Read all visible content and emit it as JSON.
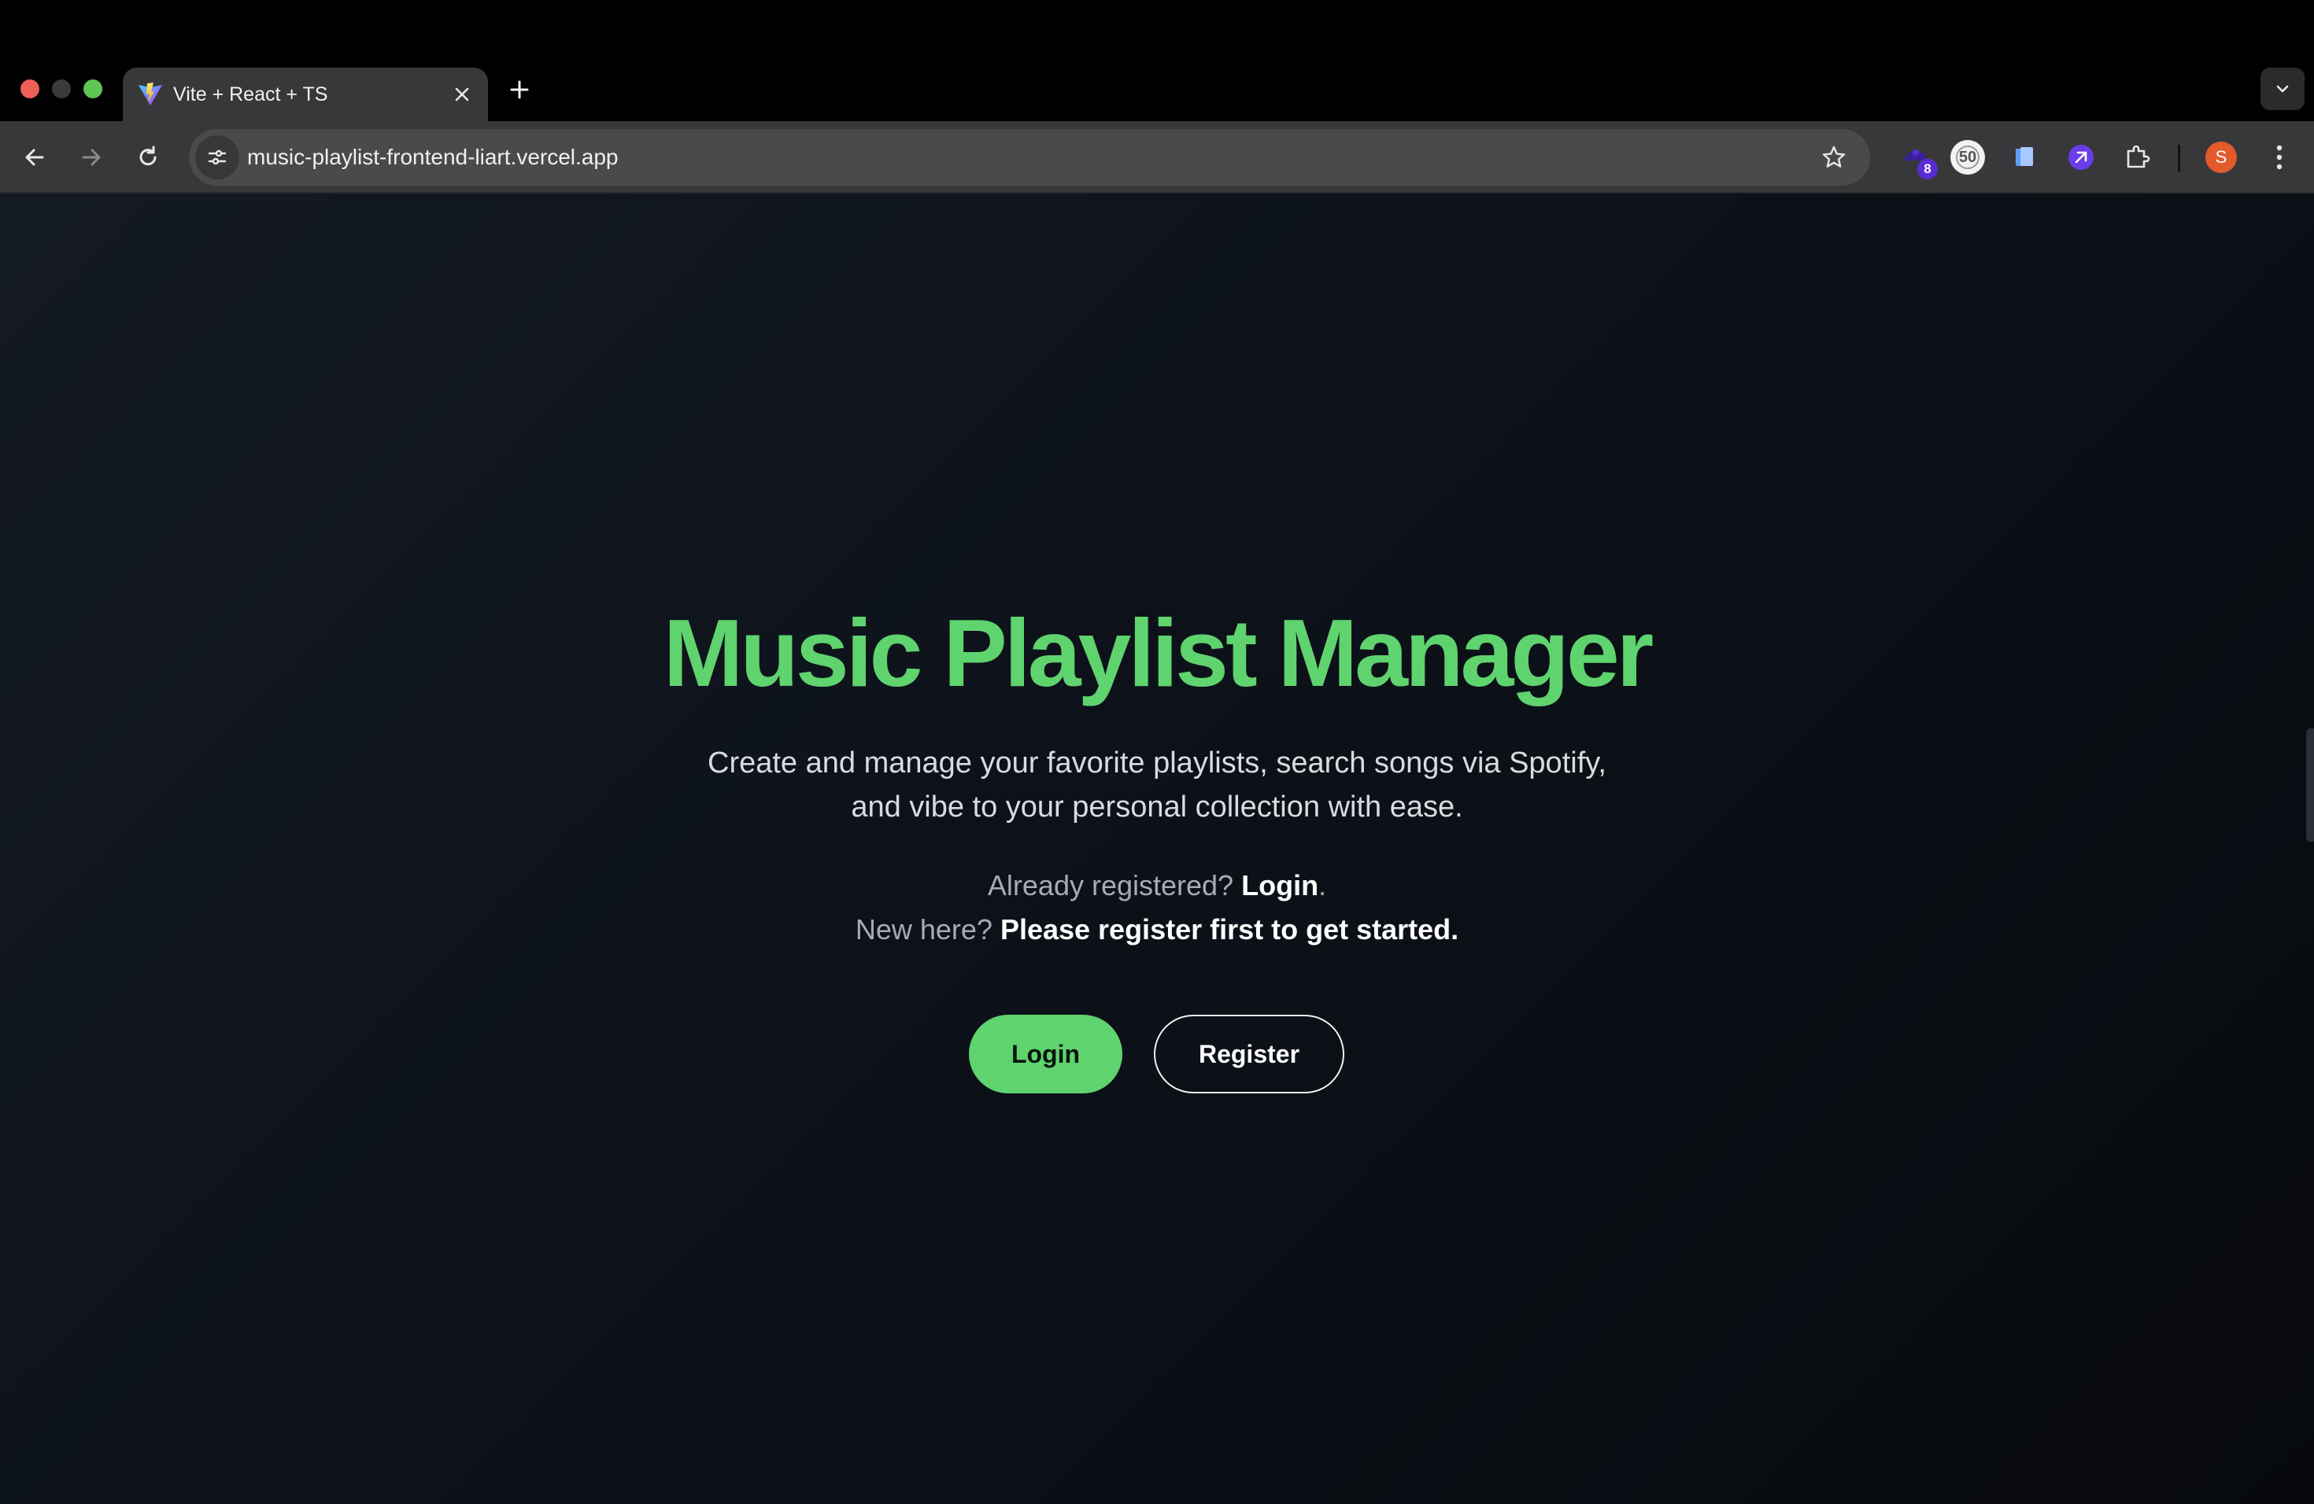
{
  "browser": {
    "tab": {
      "title": "Vite + React + TS",
      "favicon": "vite-logo-icon"
    },
    "toolbar": {
      "url": "music-playlist-frontend-liart.vercel.app",
      "extensions": [
        {
          "name": "extension-icon-1",
          "badge": "8"
        },
        {
          "name": "extension-icon-2",
          "label": "50"
        },
        {
          "name": "extension-icon-3"
        },
        {
          "name": "extension-icon-4"
        },
        {
          "name": "puzzle-icon"
        }
      ],
      "profile_initial": "S"
    }
  },
  "page": {
    "title": "Music Playlist Manager",
    "description": "Create and manage your favorite playlists, search songs via Spotify, and vibe to your personal collection with ease.",
    "line1_prefix": "Already registered?",
    "line1_link": "Login",
    "line1_suffix": ".",
    "line2_prefix": "New here?",
    "line2_emphasis": "Please register first to get started.",
    "buttons": {
      "login": "Login",
      "register": "Register"
    }
  },
  "colors": {
    "accent": "#5fd36e",
    "background_dark": "#0d121a"
  }
}
